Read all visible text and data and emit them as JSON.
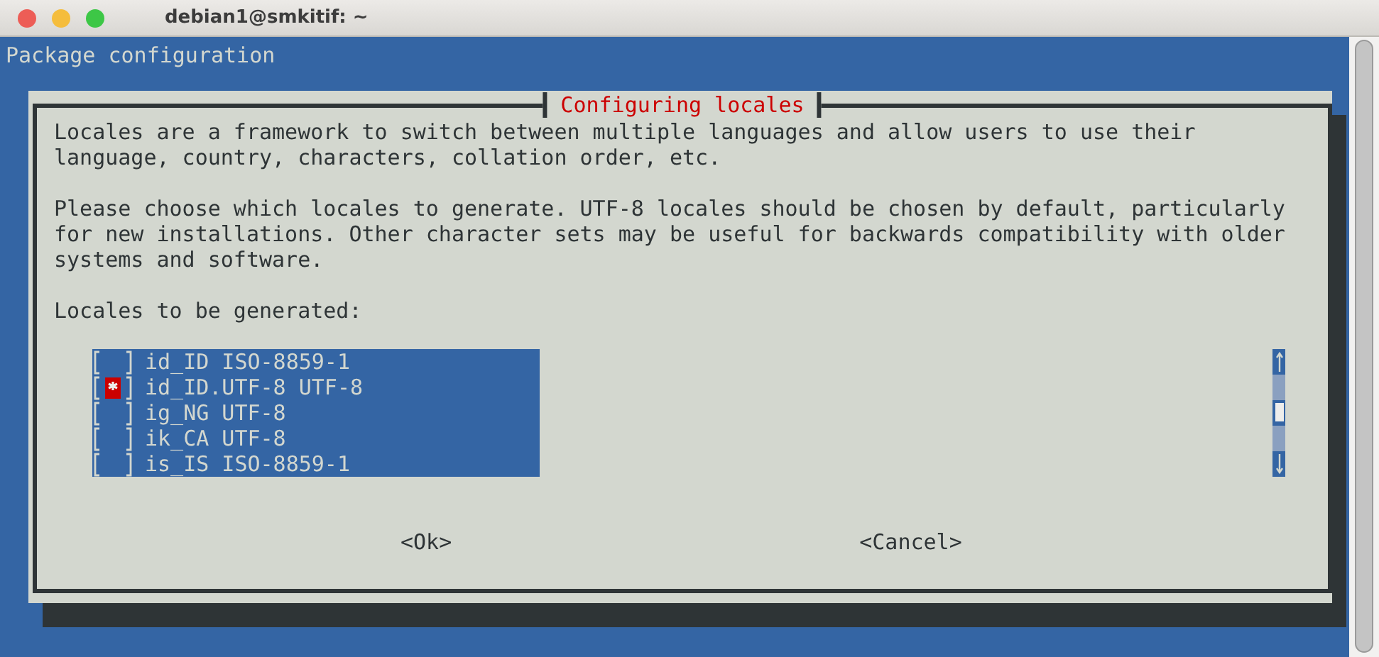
{
  "window": {
    "title": "debian1@smkitif: ~"
  },
  "header": "Package configuration",
  "dialog": {
    "title": "Configuring locales",
    "paragraphs": [
      [
        "Locales are a framework to switch between multiple languages and allow users to use their",
        "language, country, characters, collation order, etc."
      ],
      [
        "Please choose which locales to generate. UTF-8 locales should be chosen by default, particularly",
        "for new installations. Other character sets may be useful for backwards compatibility with older",
        "systems and software."
      ],
      [
        "Locales to be generated:"
      ]
    ],
    "items": [
      {
        "label": "id_ID ISO-8859-1",
        "checked": false
      },
      {
        "label": "id_ID.UTF-8 UTF-8",
        "checked": true
      },
      {
        "label": "ig_NG UTF-8",
        "checked": false
      },
      {
        "label": "ik_CA UTF-8",
        "checked": false
      },
      {
        "label": "is_IS ISO-8859-1",
        "checked": false
      }
    ],
    "buttons": [
      {
        "label": "<Ok>",
        "selected": false
      },
      {
        "label": "<Cancel>",
        "selected": false
      }
    ]
  }
}
